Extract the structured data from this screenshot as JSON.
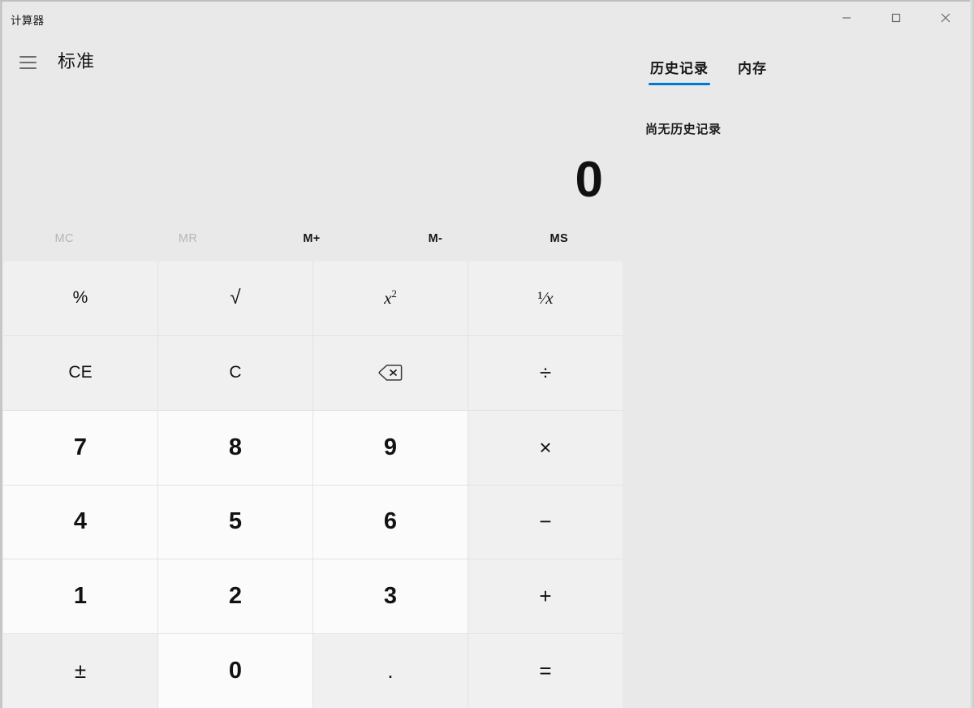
{
  "window": {
    "title": "计算器",
    "controls": [
      {
        "name": "minimize",
        "label": "–"
      },
      {
        "name": "maximize",
        "label": "□"
      },
      {
        "name": "close",
        "label": "✕"
      }
    ]
  },
  "nav": {
    "menu_icon": "hamburger-icon",
    "mode_title": "标准"
  },
  "display": {
    "expression": "",
    "value": "0"
  },
  "memory": {
    "buttons": [
      {
        "label": "MC",
        "name": "memory-clear",
        "disabled": true
      },
      {
        "label": "MR",
        "name": "memory-recall",
        "disabled": true
      },
      {
        "label": "M+",
        "name": "memory-add",
        "disabled": false
      },
      {
        "label": "M-",
        "name": "memory-subtract",
        "disabled": false
      },
      {
        "label": "MS",
        "name": "memory-store",
        "disabled": false
      }
    ]
  },
  "keypad": {
    "rows": [
      [
        {
          "label": "%",
          "name": "percent",
          "kind": "fn"
        },
        {
          "label": "√",
          "name": "square-root",
          "kind": "fn"
        },
        {
          "label": "x²",
          "name": "square",
          "kind": "fn"
        },
        {
          "label": "¹⁄x",
          "name": "reciprocal",
          "kind": "fn"
        }
      ],
      [
        {
          "label": "CE",
          "name": "clear-entry",
          "kind": "fn"
        },
        {
          "label": "C",
          "name": "clear",
          "kind": "fn"
        },
        {
          "label": "⌫",
          "name": "backspace",
          "kind": "fn"
        },
        {
          "label": "÷",
          "name": "divide",
          "kind": "op"
        }
      ],
      [
        {
          "label": "7",
          "name": "digit-7",
          "kind": "num"
        },
        {
          "label": "8",
          "name": "digit-8",
          "kind": "num"
        },
        {
          "label": "9",
          "name": "digit-9",
          "kind": "num"
        },
        {
          "label": "×",
          "name": "multiply",
          "kind": "op"
        }
      ],
      [
        {
          "label": "4",
          "name": "digit-4",
          "kind": "num"
        },
        {
          "label": "5",
          "name": "digit-5",
          "kind": "num"
        },
        {
          "label": "6",
          "name": "digit-6",
          "kind": "num"
        },
        {
          "label": "−",
          "name": "subtract",
          "kind": "op"
        }
      ],
      [
        {
          "label": "1",
          "name": "digit-1",
          "kind": "num"
        },
        {
          "label": "2",
          "name": "digit-2",
          "kind": "num"
        },
        {
          "label": "3",
          "name": "digit-3",
          "kind": "num"
        },
        {
          "label": "+",
          "name": "add",
          "kind": "op"
        }
      ],
      [
        {
          "label": "±",
          "name": "negate",
          "kind": "op"
        },
        {
          "label": "0",
          "name": "digit-0",
          "kind": "num"
        },
        {
          "label": ".",
          "name": "decimal-point",
          "kind": "op"
        },
        {
          "label": "=",
          "name": "equals",
          "kind": "equals"
        }
      ]
    ]
  },
  "side_panel": {
    "tabs": [
      {
        "label": "历史记录",
        "name": "history",
        "active": true
      },
      {
        "label": "内存",
        "name": "memory",
        "active": false
      }
    ],
    "history_empty_text": "尚无历史记录"
  },
  "colors": {
    "accent": "#0078d7",
    "window_background": "#e9e9e9",
    "digit_key": "#fbfbfb",
    "function_key": "#f0f0f0",
    "text": "#121212",
    "disabled_text": "#b6b6b6"
  }
}
